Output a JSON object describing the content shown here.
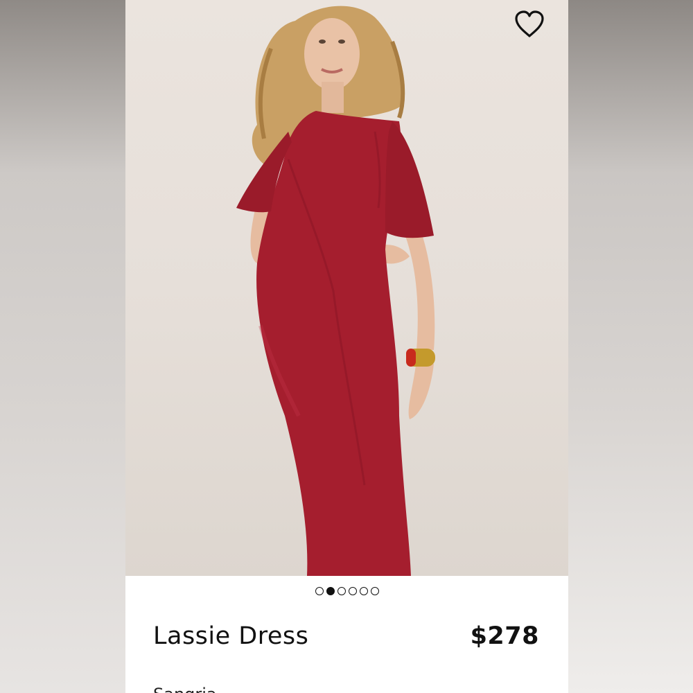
{
  "product": {
    "name": "Lassie Dress",
    "price": "$278",
    "subtext": "Sangria"
  },
  "carousel": {
    "total": 6,
    "active_index": 1
  },
  "icons": {
    "favorite": "heart-outline-icon"
  },
  "colors": {
    "dress": "#a51e2e",
    "background": "#e8e1db",
    "text": "#111111"
  }
}
